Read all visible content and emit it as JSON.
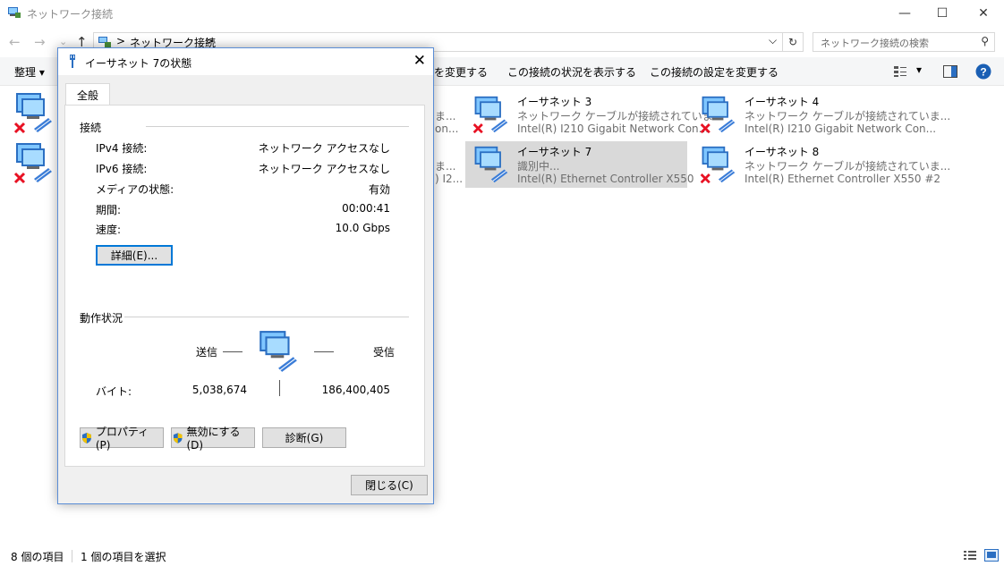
{
  "window": {
    "title": "ネットワーク接続",
    "minimize": "—",
    "maximize": "☐",
    "close": "✕"
  },
  "address": {
    "separator": ">",
    "crumb": "ネットワーク接続",
    "crumb_arrow": ">",
    "dropdown": "⌵",
    "refresh": "↻",
    "search_placeholder": "ネットワーク接続の検索",
    "search_icon": "⚲"
  },
  "nav": {
    "back": "←",
    "forward": "→",
    "recent": "⌄",
    "up": "↑"
  },
  "commandbar": {
    "organize": "整理 ▾",
    "rename_partial": "を変更する",
    "view_status": "この接続の状況を表示する",
    "change_settings": "この接続の設定を変更する",
    "view_dropdown": "▾"
  },
  "items": [
    {
      "name": "イーサネット 3",
      "status": "ネットワーク ケーブルが接続されていま...",
      "adapter": "Intel(R) I210 Gigabit Network Con...",
      "disconnected": true,
      "selected": false
    },
    {
      "name": "イーサネット 4",
      "status": "ネットワーク ケーブルが接続されていま...",
      "adapter": "Intel(R) I210 Gigabit Network Con...",
      "disconnected": true,
      "selected": false
    },
    {
      "name": "イーサネット 7",
      "status": "識別中...",
      "adapter": "Intel(R) Ethernet Controller X550",
      "disconnected": false,
      "selected": true
    },
    {
      "name": "イーサネット 8",
      "status": "ネットワーク ケーブルが接続されていま...",
      "adapter": "Intel(R) Ethernet Controller X550 #2",
      "disconnected": true,
      "selected": false
    }
  ],
  "hidden_fragments": {
    "r1a": "ま...",
    "r1b": "on...",
    "r2a": "ま...",
    "r2b": ") I2..."
  },
  "statusbar": {
    "count": "8 個の項目",
    "selected": "1 個の項目を選択"
  },
  "dialog": {
    "title": "イーサネット 7の状態",
    "tab": "全般",
    "connection_group": "接続",
    "rows": [
      {
        "label": "IPv4 接続:",
        "value": "ネットワーク アクセスなし"
      },
      {
        "label": "IPv6 接続:",
        "value": "ネットワーク アクセスなし"
      },
      {
        "label": "メディアの状態:",
        "value": "有効"
      },
      {
        "label": "期間:",
        "value": "00:00:41"
      },
      {
        "label": "速度:",
        "value": "10.0 Gbps"
      }
    ],
    "details_button": "詳細(E)...",
    "activity_group": "動作状況",
    "sent_label": "送信",
    "received_label": "受信",
    "bytes_label": "バイト:",
    "bytes_sent": "5,038,674",
    "bytes_received": "186,400,405",
    "properties_button": "プロパティ(P)",
    "disable_button": "無効にする(D)",
    "diagnose_button": "診断(G)",
    "close_button": "閉じる(C)",
    "close_icon": "✕"
  }
}
